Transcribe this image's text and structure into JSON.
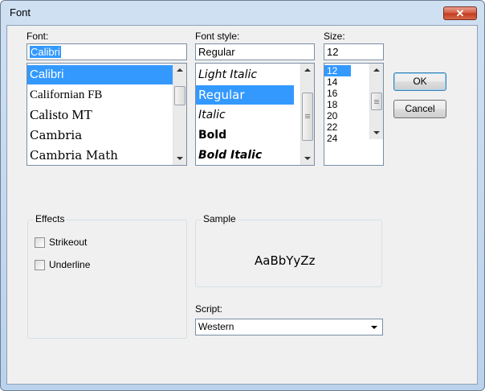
{
  "window": {
    "title": "Font",
    "close_icon_glyph": "✕"
  },
  "font": {
    "label": "Font:",
    "value": "Calibri",
    "items": [
      "Calibri",
      "Californian FB",
      "Calisto MT",
      "Cambria",
      "Cambria Math"
    ],
    "selected_index": 0
  },
  "style": {
    "label": "Font style:",
    "value": "Regular",
    "items": [
      "Light Italic",
      "Regular",
      "Italic",
      "Bold",
      "Bold Italic"
    ],
    "selected_index": 1
  },
  "size": {
    "label": "Size:",
    "value": "12",
    "items": [
      "12",
      "14",
      "16",
      "18",
      "20",
      "22",
      "24"
    ],
    "selected_index": 0
  },
  "buttons": {
    "ok": "OK",
    "cancel": "Cancel"
  },
  "effects": {
    "title": "Effects",
    "strikeout": "Strikeout",
    "underline": "Underline",
    "strikeout_checked": false,
    "underline_checked": false
  },
  "sample": {
    "title": "Sample",
    "text": "AaBbYyZz"
  },
  "script": {
    "label": "Script:",
    "value": "Western"
  },
  "colors": {
    "selection": "#3399ff",
    "dialog_bg": "#f0f0f0",
    "title_gradient": "#bad2ec",
    "close_red": "#c2391c"
  }
}
